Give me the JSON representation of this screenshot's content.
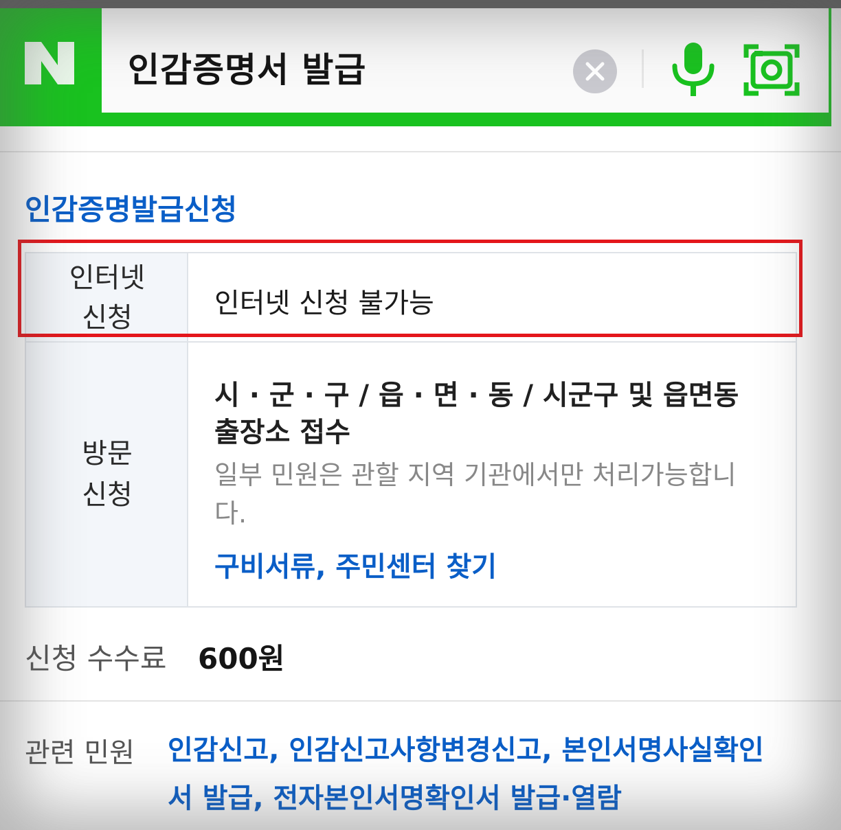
{
  "search": {
    "logo": "N",
    "query": "인감증명서 발급",
    "brand_color": "#19c21f",
    "icons": [
      "clear-icon",
      "microphone-icon",
      "smart-lens-icon"
    ]
  },
  "result": {
    "title": "인감증명발급신청",
    "rows": [
      {
        "header_line1": "인터넷",
        "header_line2": "신청",
        "value": "인터넷 신청 불가능"
      },
      {
        "header_line1": "방문",
        "header_line2": "신청",
        "value_line1": "시 · 군 · 구 / 읍 · 면 · 동 / 시군구 및 읍면동",
        "value_line2": "출장소 접수",
        "note_line1": "일부 민원은 관할 지역 기관에서만 처리가능합니",
        "note_line2": "다.",
        "link": "구비서류, 주민센터 찾기"
      }
    ],
    "fee_label": "신청 수수료",
    "fee_value": "600원",
    "related_label": "관련 민원",
    "related_links": [
      "인감신고",
      "인감신고사항변경신고",
      "본인서명사실확인서 발급",
      "전자본인서명확인서 발급·열람"
    ],
    "highlight_color": "#e4161b",
    "link_color": "#0a5ec7"
  }
}
